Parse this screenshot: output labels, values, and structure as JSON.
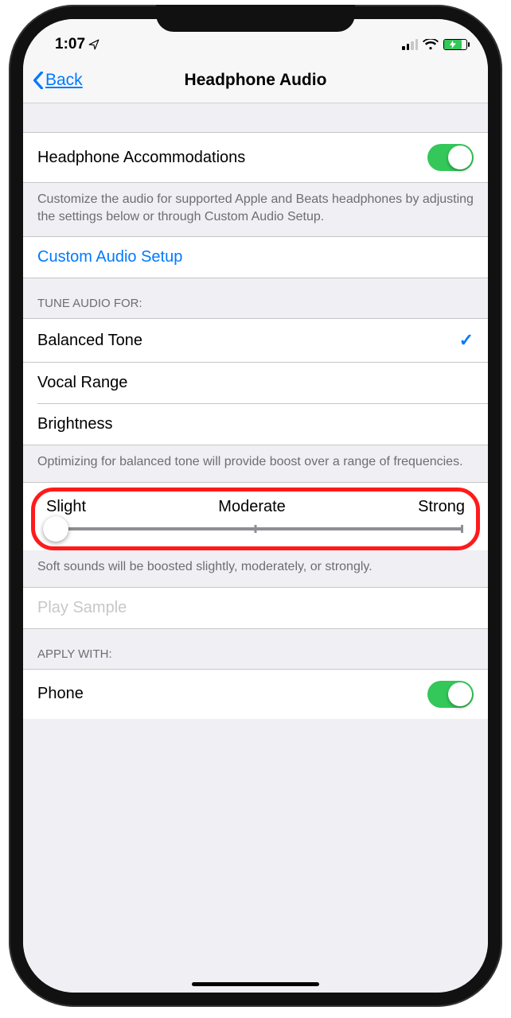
{
  "status": {
    "time": "1:07"
  },
  "nav": {
    "back": "Back",
    "title": "Headphone Audio"
  },
  "accommodations": {
    "label": "Headphone Accommodations",
    "footer": "Customize the audio for supported Apple and Beats headphones by adjusting the settings below or through Custom Audio Setup."
  },
  "customSetup": {
    "label": "Custom Audio Setup"
  },
  "tune": {
    "header": "Tune Audio For:",
    "options": [
      "Balanced Tone",
      "Vocal Range",
      "Brightness"
    ],
    "selectedIndex": 0,
    "footer": "Optimizing for balanced tone will provide boost over a range of frequencies."
  },
  "boost": {
    "labels": {
      "low": "Slight",
      "mid": "Moderate",
      "high": "Strong"
    },
    "footer": "Soft sounds will be boosted slightly, moderately, or strongly."
  },
  "playSample": {
    "label": "Play Sample"
  },
  "apply": {
    "header": "Apply With:",
    "phone": "Phone"
  }
}
